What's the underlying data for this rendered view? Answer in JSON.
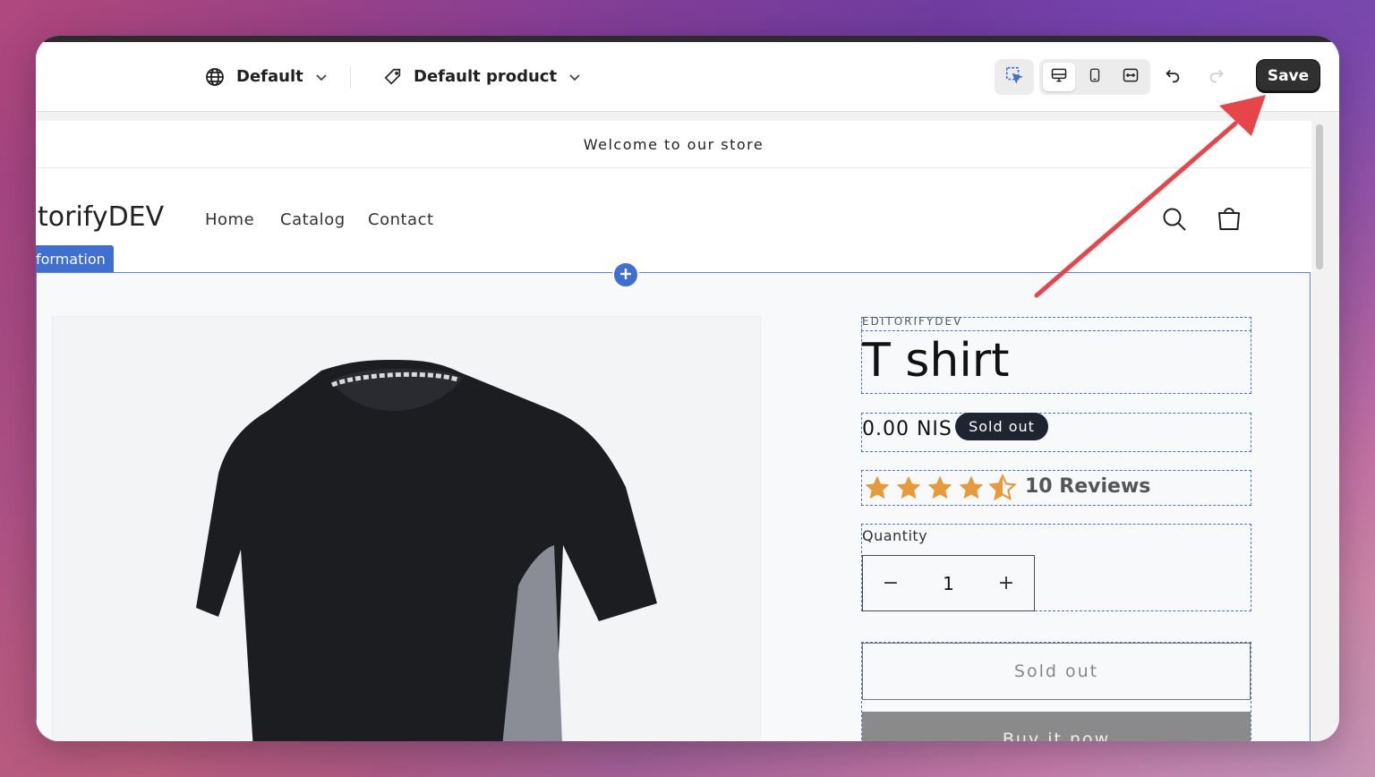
{
  "toolbar": {
    "locale_label": "Default",
    "template_label": "Default product",
    "save_label": "Save"
  },
  "store": {
    "announcement": "Welcome to our store",
    "logo": "torifyDEV",
    "nav": [
      "Home",
      "Catalog",
      "Contact"
    ],
    "section_tag": "formation"
  },
  "product": {
    "vendor": "EDITORIFYDEV",
    "title": "T shirt",
    "price": "0.00 NIS",
    "badge": "Sold out",
    "rating": 4.5,
    "reviews": "10 Reviews",
    "quantity_label": "Quantity",
    "quantity_value": "1",
    "stepper_minus": "−",
    "stepper_plus": "+",
    "sold_out_button": "Sold out",
    "buy_now_button": "Buy it now"
  },
  "colors": {
    "accent_blue": "#3e6fd1",
    "star": "#e69a3a",
    "save_bg": "#303030",
    "arrow": "#e8454a"
  }
}
